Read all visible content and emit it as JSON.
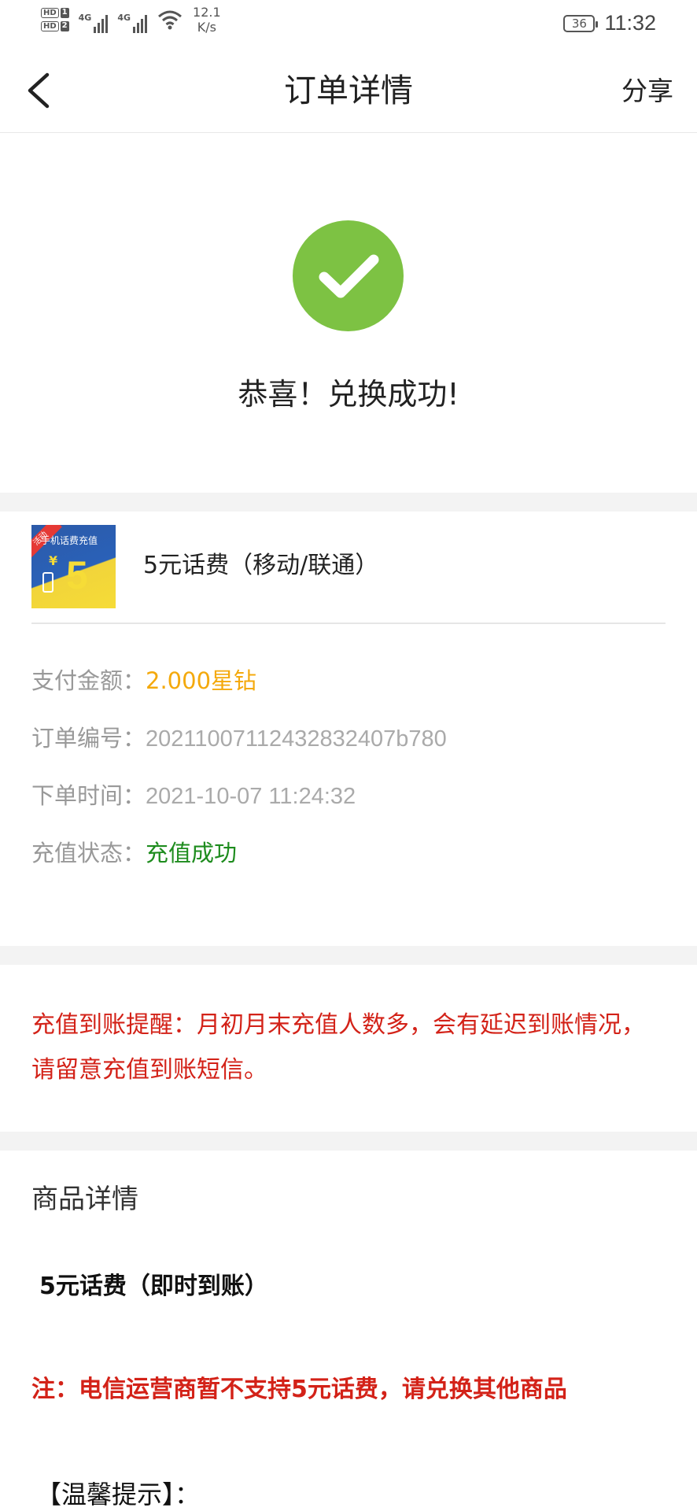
{
  "status_bar": {
    "hd1": "HD",
    "hd1_num": "1",
    "hd2": "HD",
    "hd2_num": "2",
    "net1": "4G",
    "net2": "4G",
    "speed_value": "12.1",
    "speed_unit": "K/s",
    "battery": "36",
    "time": "11:32"
  },
  "nav": {
    "title": "订单详情",
    "share": "分享"
  },
  "success": {
    "message": "恭喜！兑换成功!"
  },
  "product": {
    "thumb_ribbon": "活动",
    "thumb_title": "手机话费充值",
    "thumb_yen": "¥",
    "thumb_amount": "5",
    "name": "5元话费（移动/联通）"
  },
  "order": {
    "pay_label": "支付金额：",
    "pay_value": "2.000星钻",
    "number_label": "订单编号：",
    "number_value": "20211007112432832407b780",
    "time_label": "下单时间：",
    "time_value": "2021-10-07 11:24:32",
    "status_label": "充值状态：",
    "status_value": "充值成功"
  },
  "notice": {
    "text": "充值到账提醒：月初月末充值人数多，会有延迟到账情况，请留意充值到账短信。"
  },
  "details": {
    "title": "商品详情",
    "product_line": "5元话费（即时到账）",
    "warning": "注：电信运营商暂不支持5元话费，请兑换其他商品",
    "tip": "【温馨提示】："
  },
  "colors": {
    "accent_green": "#7dc243",
    "gold": "#f4a90c",
    "status_green": "#1e8c1e",
    "warning_red": "#d32218"
  }
}
